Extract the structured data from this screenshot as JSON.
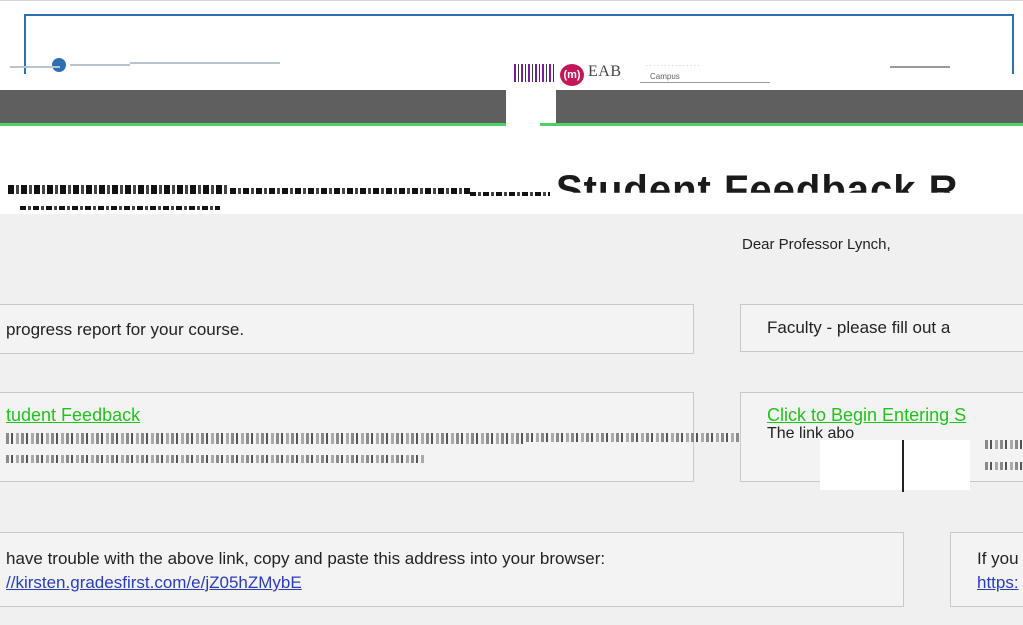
{
  "colors": {
    "accent_green": "#22c21d",
    "link_blue": "#2a3db8",
    "band_gray": "#5f5f5f",
    "frame_blue": "#2d6fb5"
  },
  "header": {
    "logo_badge": "(m)",
    "logo_text": "EAB",
    "logo_sub": "Campus",
    "headline": "Student Feedback R"
  },
  "email": {
    "greeting": "Dear Professor Lynch,",
    "left_column": {
      "intro": "progress report for your course.",
      "link_label": "tudent Feedback",
      "help_text": "have trouble with the above link, copy and paste this address into your browser:",
      "url": "//kirsten.gradesfirst.com/e/jZ05hZMybE"
    },
    "right_column": {
      "intro": "Faculty - please fill out a",
      "link_label": "Click to Begin Entering S",
      "link_note": "The link abo",
      "help_text": "If you",
      "url": "https:"
    }
  }
}
